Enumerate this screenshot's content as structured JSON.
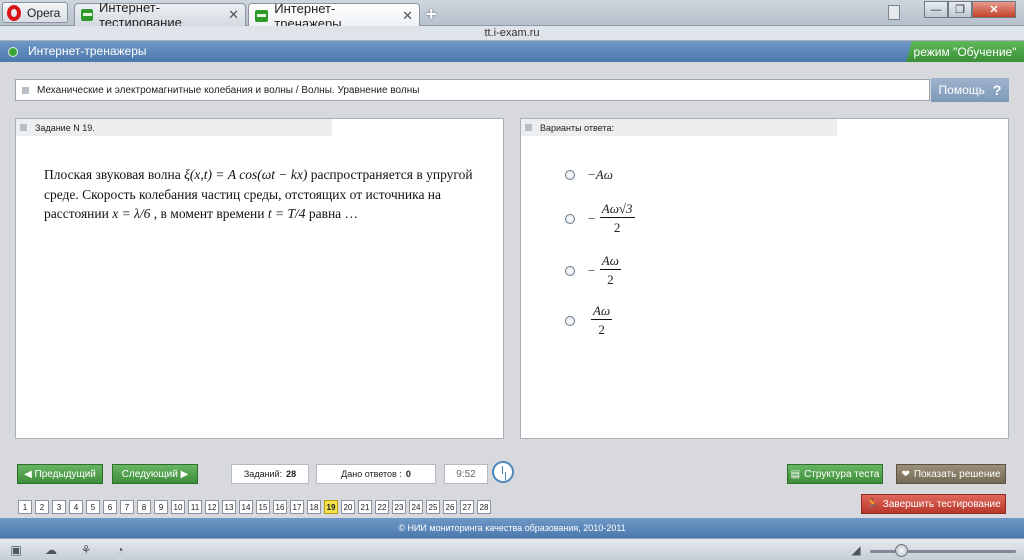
{
  "browser": {
    "menu_label": "Opera",
    "tabs": [
      {
        "label": "Интернет-тестирование",
        "close": "✕"
      },
      {
        "label": "Интернет-тренажеры",
        "close": "✕"
      }
    ],
    "new_tab": "+",
    "address": "tt.i-exam.ru",
    "window_controls": {
      "minimize": "—",
      "restore": "❐",
      "close": "✕"
    }
  },
  "app": {
    "title": "Интернет-тренажеры",
    "mode": "режим \"Обучение\"",
    "breadcrumb": "Механические и электромагнитные колебания и волны / Волны. Уравнение волны",
    "help_label": "Помощь",
    "help_icon": "?"
  },
  "task_panel": {
    "header": "Задание N 19.",
    "text": {
      "p1": "Плоская звуковая волна ",
      "eq": "ξ(x,t) = A cos(ωt − kx)",
      "p2": " распространяется в упругой среде. Скорость колебания частиц среды, отстоящих от источника на расстоянии ",
      "x_cond": "x = λ/6",
      "p3": " , в момент времени ",
      "t_cond": "t = T/4",
      "p4": "  равна …"
    }
  },
  "answers_panel": {
    "header": "Варианты ответа:",
    "options": [
      {
        "sign": "− ",
        "num": "Aω",
        "den": ""
      },
      {
        "sign": "− ",
        "num": "Aω√3",
        "den": "2"
      },
      {
        "sign": "− ",
        "num": "Aω",
        "den": "2"
      },
      {
        "sign": "",
        "num": "Aω",
        "den": "2"
      }
    ]
  },
  "controls": {
    "prev_label": "Предыдущий",
    "next_label": "Следующий",
    "tasks_label": "Заданий:",
    "tasks_count": "28",
    "answered_label": "Дано ответов :",
    "answered_count": "0",
    "timer": "9:52",
    "structure_label": "Структура теста",
    "show_solution_label": "Показать решение",
    "finish_label": "Завершить тестирование",
    "current_page": 19,
    "pages": [
      "1",
      "2",
      "3",
      "4",
      "5",
      "6",
      "7",
      "8",
      "9",
      "10",
      "11",
      "12",
      "13",
      "14",
      "15",
      "16",
      "17",
      "18",
      "19",
      "20",
      "21",
      "22",
      "23",
      "24",
      "25",
      "26",
      "27",
      "28"
    ]
  },
  "footer": "© НИИ мониторинга качества образования, 2010-2011",
  "colors": {
    "accent_blue": "#4b79ad",
    "accent_green": "#3e8e3a",
    "accent_red": "#b8372a",
    "current_page": "#f4e44a"
  }
}
